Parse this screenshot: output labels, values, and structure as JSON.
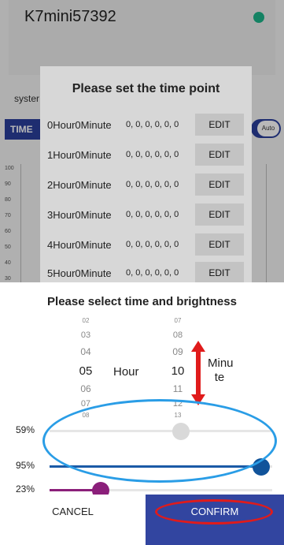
{
  "app": {
    "device_name": "K7mini57392",
    "system_label": "syster",
    "time_tab": "TIME",
    "auto_toggle": "Auto",
    "y_ticks": [
      "100",
      "90",
      "80",
      "70",
      "60",
      "50",
      "40",
      "30"
    ],
    "status_color": "#1db58a"
  },
  "time_point_dialog": {
    "title": "Please set the time point",
    "edit_label": "EDIT",
    "rows": [
      {
        "label": "0Hour0Minute",
        "values": "0, 0, 0, 0, 0, 0"
      },
      {
        "label": "1Hour0Minute",
        "values": "0, 0, 0, 0, 0, 0"
      },
      {
        "label": "2Hour0Minute",
        "values": "0, 0, 0, 0, 0, 0"
      },
      {
        "label": "3Hour0Minute",
        "values": "0, 0, 0, 0, 0, 0"
      },
      {
        "label": "4Hour0Minute",
        "values": "0, 0, 0, 0, 0, 0"
      },
      {
        "label": "5Hour0Minute",
        "values": "0, 0, 0, 0, 0, 0"
      }
    ]
  },
  "sheet": {
    "title": "Please select time and brightness",
    "hour_wheel": [
      "02",
      "03",
      "04",
      "05",
      "06",
      "07",
      "08"
    ],
    "hour_selected": "05",
    "hour_unit": "Hour",
    "minute_wheel": [
      "07",
      "08",
      "09",
      "10",
      "11",
      "12",
      "13"
    ],
    "minute_selected": "10",
    "minute_unit_line1": "Minu",
    "minute_unit_line2": "te",
    "sliders": [
      {
        "label": "59%",
        "value": 0.59,
        "track_color": "#e6e6e6",
        "fill_color": "#e6e6e6",
        "thumb_color": "#d9d9d9"
      },
      {
        "label": "95%",
        "value": 0.95,
        "track_color": "#e6e6e6",
        "fill_color": "#1b5aa6",
        "thumb_color": "#11539a"
      },
      {
        "label": "23%",
        "value": 0.23,
        "track_color": "#e6e6e6",
        "fill_color": "#8b1f7a",
        "thumb_color": "#8b1f7a"
      }
    ],
    "cancel_label": "CANCEL",
    "confirm_label": "CONFIRM"
  },
  "colors": {
    "accent": "#3245a0",
    "annotation_blue": "#2a9de6",
    "annotation_red": "#e01b1b"
  }
}
